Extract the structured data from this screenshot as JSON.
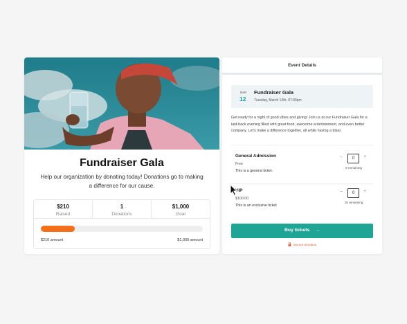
{
  "campaign": {
    "title": "Fundraiser Gala",
    "description": "Help our organization by donating today! Donations go to making a difference for our cause.",
    "stats": [
      {
        "value": "$210",
        "label": "Raised"
      },
      {
        "value": "1",
        "label": "Donations"
      },
      {
        "value": "$1,000",
        "label": "Goal"
      }
    ],
    "progress_fraction": 0.21,
    "amount_left": "$210 amount",
    "amount_right": "$1,000 amount"
  },
  "event_details": {
    "header": "Event Details",
    "month": "MAR",
    "day": "12",
    "title": "Fundraiser Gala",
    "datetime": "Tuesday, March 12th, 07:00pm",
    "description": "Get ready for a night of good vibes and giving! Join us at our Fundraiser Gala for a laid-back evening filled with great food, awesome entertainment, and even better company. Let's make a difference together, all while having a blast.",
    "tickets": [
      {
        "name": "General Admission",
        "price": "Free",
        "info": "This is a general ticket.",
        "qty": "0",
        "remaining": "9 remaining"
      },
      {
        "name": "VIP",
        "price": "$100.00",
        "info": "This is an exclusive ticket",
        "qty": "0",
        "remaining": "15 remaining"
      }
    ],
    "qty_minus": "−",
    "qty_plus": "+",
    "buy_label": "Buy tickets",
    "buy_arrow": "→",
    "secure_label": "Secure donation"
  },
  "colors": {
    "accent": "#1ea596",
    "progress": "#f36f1a"
  },
  "icons": [
    "arrow-right-icon",
    "lock-icon",
    "mouse-cursor-icon"
  ]
}
